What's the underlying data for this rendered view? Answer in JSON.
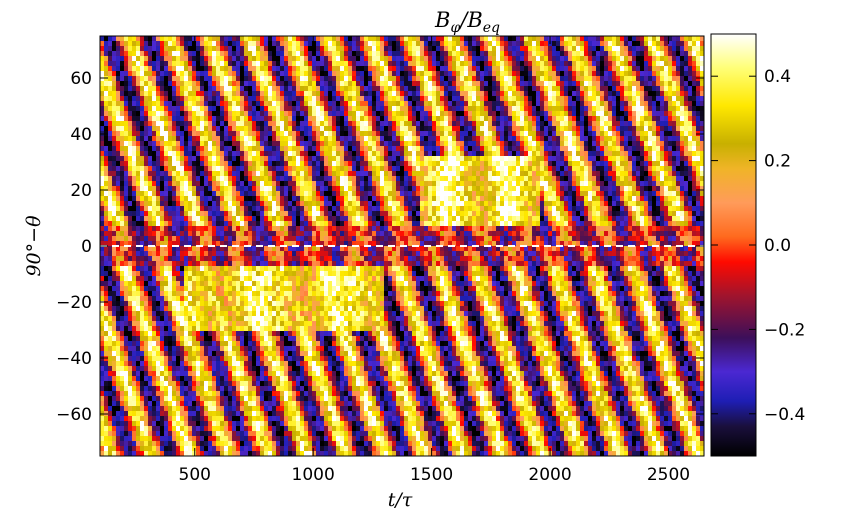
{
  "chart_data": {
    "type": "heatmap",
    "title": "B_φ/B_eq",
    "title_parts": {
      "num": "B",
      "num_sub": "φ",
      "slash": "/",
      "den": "B",
      "den_sub": "eq"
    },
    "xlabel": "t/τ",
    "ylabel": "90°−θ",
    "xlim": [
      100,
      2650
    ],
    "ylim": [
      -75,
      75
    ],
    "xticks": [
      500,
      1000,
      1500,
      2000,
      2500
    ],
    "yticks": [
      -60,
      -40,
      -20,
      0,
      20,
      40,
      60
    ],
    "colorbar": {
      "range": [
        -0.5,
        0.5
      ],
      "ticks": [
        -0.4,
        -0.2,
        0.0,
        0.2,
        0.4
      ],
      "tick_labels": [
        "−0.4",
        "−0.2",
        "0.0",
        "0.2",
        "0.4"
      ],
      "colormap": [
        [
          -0.5,
          "#000000"
        ],
        [
          -0.43,
          "#1a0f3c"
        ],
        [
          -0.37,
          "#1e1eb4"
        ],
        [
          -0.3,
          "#4b28d2"
        ],
        [
          -0.22,
          "#3c0f5a"
        ],
        [
          -0.12,
          "#a0142d"
        ],
        [
          -0.04,
          "#ff0a00"
        ],
        [
          0.02,
          "#ff6a1e"
        ],
        [
          0.1,
          "#ff9b5a"
        ],
        [
          0.18,
          "#f0b428"
        ],
        [
          0.24,
          "#c8b000"
        ],
        [
          0.33,
          "#ffe800"
        ],
        [
          0.42,
          "#ffff78"
        ],
        [
          0.5,
          "#ffffff"
        ]
      ]
    },
    "equator_line": {
      "y": 0,
      "style": "dashed",
      "color": "#ffffff"
    },
    "pattern_note_values": {
      "northern_stripe_period": 170,
      "southern_stripe_period": 165
    }
  }
}
